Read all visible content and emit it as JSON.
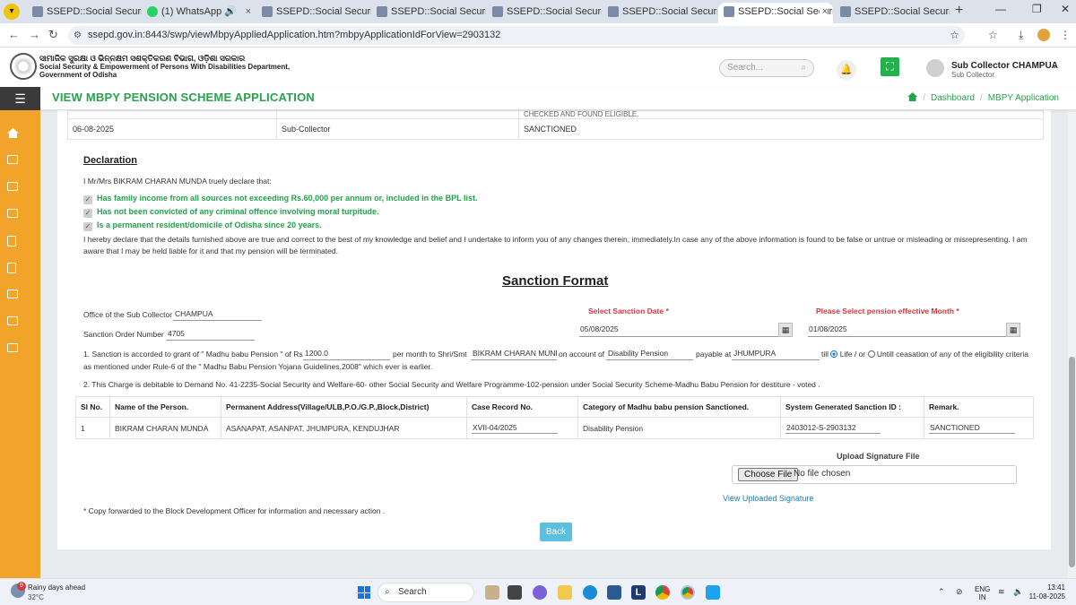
{
  "browser": {
    "tabs": [
      {
        "label": "SSEPD::Social Security & E",
        "active": false
      },
      {
        "label": "(1) WhatsApp",
        "active": false
      },
      {
        "label": "SSEPD::Social Security & E",
        "active": false
      },
      {
        "label": "SSEPD::Social Security & E",
        "active": false
      },
      {
        "label": "SSEPD::Social Security & E",
        "active": false
      },
      {
        "label": "SSEPD::Social Security & E",
        "active": false
      },
      {
        "label": "SSEPD::Social Security & E",
        "active": true
      },
      {
        "label": "SSEPD::Social Security & E",
        "active": false
      }
    ],
    "url": "ssepd.gov.in:8443/swp/viewMbpyAppliedApplication.htm?mbpyApplicationIdForView=2903132"
  },
  "header": {
    "dept_odia": "ସାମାଜିକ ସୁରକ୍ଷା ଓ ଭିନ୍ନକ୍ଷମ ସଶକ୍ତିକରଣ ବିଭାଗ, ଓଡ଼ିଶା ସରକାର",
    "dept_line1": "Social Security & Empowerment of Persons With Disabilities Department,",
    "dept_line2": "Government of Odisha",
    "search_placeholder": "Search...",
    "user_name": "Sub Collector CHAMPUA",
    "user_role": "Sub Collector"
  },
  "titlebar": {
    "title": "VIEW MBPY PENSION SCHEME APPLICATION",
    "crumb_dashboard": "Dashboard",
    "crumb_current": "MBPY Application"
  },
  "history": {
    "clipped_text": "CHECKED AND FOUND ELIGIBLE.",
    "row": {
      "date": "06-08-2025",
      "role": "Sub-Collector",
      "status": "SANCTIONED"
    }
  },
  "declaration": {
    "heading": "Declaration",
    "intro": "I Mr/Mrs BIKRAM CHARAN MUNDA truely declare that:",
    "items": [
      "Has family income from all sources not exceeding Rs.60,000 per annum or, included in the BPL list.",
      "Has not been convicted of any criminal offence involving moral turpitude.",
      "Is a permanent resident/domicile of Odisha since 20 years."
    ],
    "paragraph": "I hereby declare that the details furnished above are true and correct to the best of my knowledge and belief and I undertake to inform you of any changes therein, immediately.In case any of the above information is found to be false or untrue or misleading or misrepresenting. I am aware that I may be held liable for it and that my pension will be terminated."
  },
  "sanction": {
    "heading": "Sanction Format",
    "office_label": "Office of the Sub Collector",
    "office_value": "CHAMPUA",
    "order_label": "Sanction Order Number",
    "order_value": "4705",
    "date_label": "Select Sanction Date *",
    "date_value": "05/08/2025",
    "month_label": "Please Select pension effective Month *",
    "month_value": "01/08/2025",
    "p1_a": "1. Sanction is accorded to grant of \" Madhu babu Pension \" of Rs",
    "amount": "1200.0",
    "p1_b": "per month to Shri/Smt",
    "person": "BIKRAM CHARAN MUNDA",
    "p1_c": "on account of",
    "category": "Disability Pension",
    "p1_d": "payable at",
    "place": "JHUMPURA",
    "p1_e": "till",
    "life_label": "Life / or",
    "until_label": "Untill ceasation of any of the eligibility criteria",
    "p1_f": "as mentioned under Rule-6 of the \" Madhu Babu Pension Yojana Guidelines,2008\" which ever is earlier.",
    "p2": "2. This Charge is debitable to Demand No. 41-2235-Social Security and Welfare-60- other Social Security and Welfare Programme-102-pension under Social Security Scheme-Madhu Babu Pension for destiture - voted ."
  },
  "table": {
    "headers": [
      "Sl No.",
      "Name of the Person.",
      "Permanent Address(Village/ULB,P.O./G.P.,Block,District)",
      "Case Record No.",
      "Category of Madhu babu pension Sanctioned.",
      "System Generated Sanction ID :",
      "Remark."
    ],
    "row": {
      "sl": "1",
      "name": "BIKRAM CHARAN MUNDA",
      "address": "ASANAPAT, ASANPAT, JHUMPURA, KENDUJHAR",
      "case": "XVII-04/2025",
      "category": "Disability Pension",
      "sanction_id": "2403012-S-2903132",
      "remark": "SANCTIONED"
    }
  },
  "upload": {
    "label": "Upload Signature File",
    "choose": "Choose File",
    "nofile": "No file chosen",
    "view_link": "View Uploaded Signature"
  },
  "footer_note": "* Copy forwarded to the Block Development Officer for information and necessary action .",
  "back_label": "Back",
  "taskbar": {
    "weather_count": "9",
    "weather_text": "Rainy days ahead",
    "temp": "32°C",
    "search": "Search",
    "lang1": "ENG",
    "lang2": "IN",
    "time": "13:41",
    "date": "11-08-2025"
  },
  "colors": {
    "accent_green": "#27a34b",
    "sidebar_orange": "#f2a32a",
    "required_red": "#d9363e",
    "link_blue": "#1a7fc1",
    "back_button": "#5bc0de"
  }
}
